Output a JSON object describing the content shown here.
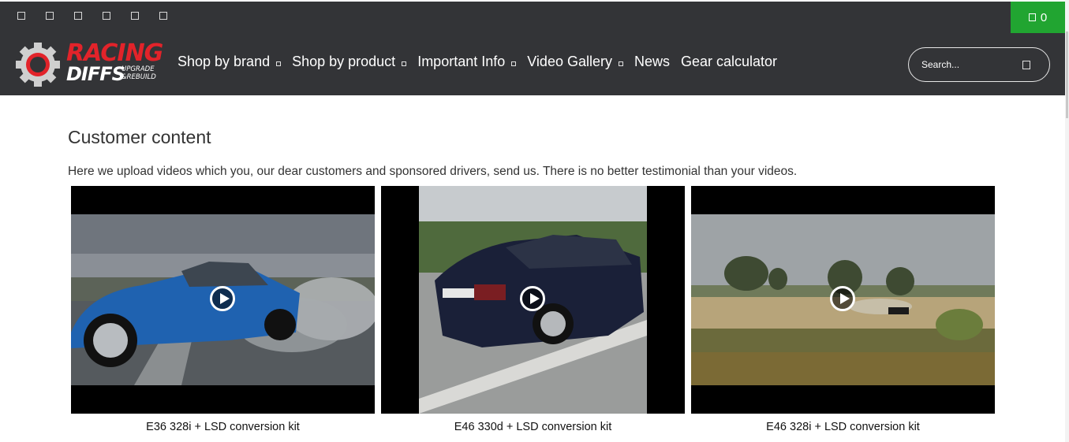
{
  "topbar": {
    "social_icons": [
      "facebook-icon",
      "instagram-icon",
      "youtube-icon",
      "twitter-icon",
      "linkedin-icon",
      "tiktok-icon"
    ],
    "cart_count": "0",
    "cart_color": "#21a531"
  },
  "brand": {
    "line1": "RACING",
    "line2": "DIFFS",
    "sub1": "UPGRADE",
    "sub2": "&REBUILD",
    "accent": "#e2232a"
  },
  "nav": {
    "items": [
      {
        "label": "Shop by brand"
      },
      {
        "label": "Shop by product"
      },
      {
        "label": "Important Info"
      },
      {
        "label": "Video Gallery"
      },
      {
        "label": "News"
      },
      {
        "label": "Gear calculator"
      }
    ],
    "background": "#333437"
  },
  "search": {
    "placeholder": "Search..."
  },
  "main": {
    "title": "Customer content",
    "description": "Here we upload videos which you, our dear customers and sponsored drivers, send us. There is no better testimonial than your videos.",
    "videos": [
      {
        "caption": "E36 328i + LSD conversion kit"
      },
      {
        "caption": "E46 330d + LSD conversion kit"
      },
      {
        "caption": "E46 328i + LSD conversion kit"
      }
    ]
  }
}
